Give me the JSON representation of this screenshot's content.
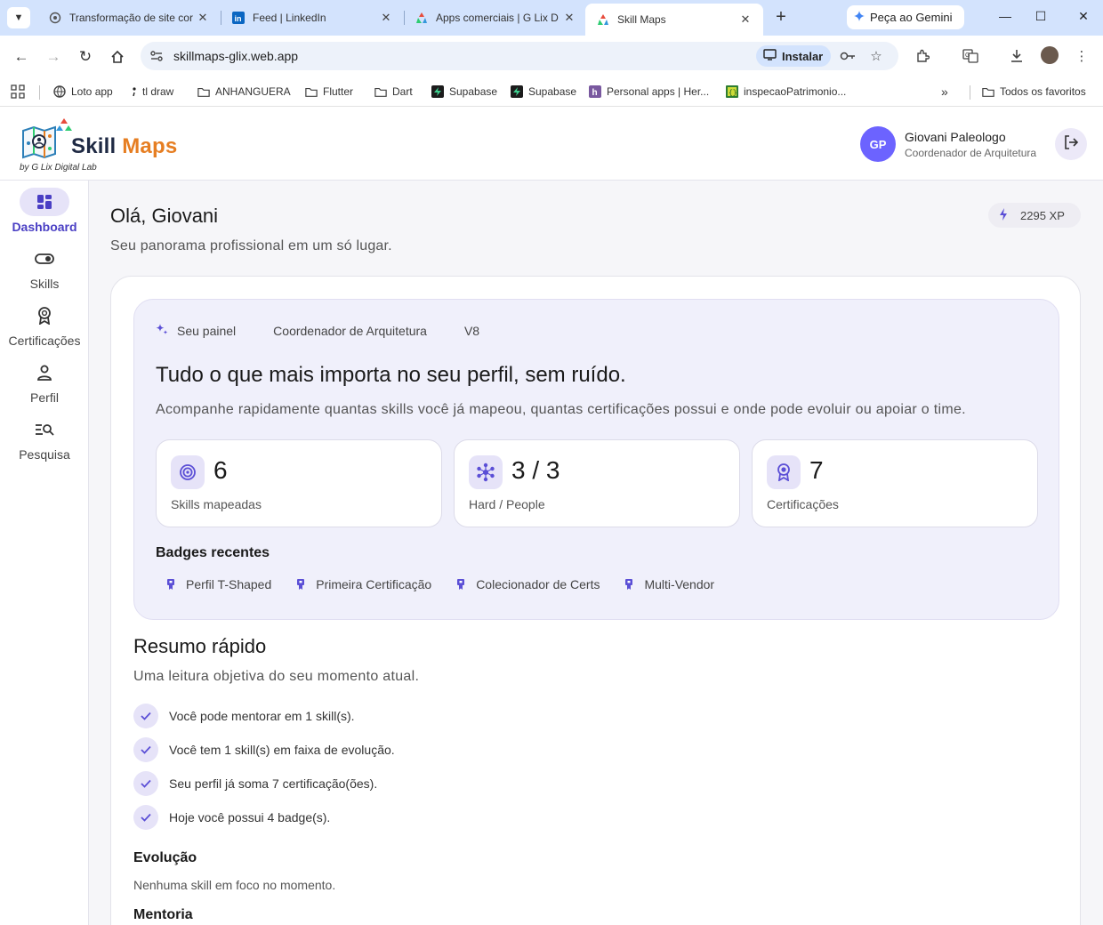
{
  "browser": {
    "tabs": [
      {
        "title": "Transformação de site cor",
        "icon": "openai-icon"
      },
      {
        "title": "Feed | LinkedIn",
        "icon": "linkedin-icon"
      },
      {
        "title": "Apps comerciais | G Lix D",
        "icon": "glix-icon"
      },
      {
        "title": "Skill Maps",
        "icon": "glix-icon",
        "active": true
      }
    ],
    "gemini_label": "Peça ao Gemini",
    "url": "skillmaps-glix.web.app",
    "install_label": "Instalar",
    "bookmarks": [
      {
        "label": "Loto app",
        "icon": "globe-icon"
      },
      {
        "label": "tl draw",
        "icon": "tldraw-icon"
      },
      {
        "label": "ANHANGUERA",
        "icon": "folder-icon"
      },
      {
        "label": "Flutter",
        "icon": "folder-icon"
      },
      {
        "label": "Dart",
        "icon": "folder-icon"
      },
      {
        "label": "Supabase",
        "icon": "supabase-icon"
      },
      {
        "label": "Supabase",
        "icon": "supabase-icon"
      },
      {
        "label": "Personal apps | Her...",
        "icon": "heroku-icon"
      },
      {
        "label": "inspecaoPatrimonio...",
        "icon": "script-icon"
      }
    ],
    "all_bookmarks_label": "Todos os favoritos"
  },
  "header": {
    "logo_word1": "Skill",
    "logo_word2": "Maps",
    "logo_sub": "by G Lix Digital Lab",
    "user_initials": "GP",
    "user_name": "Giovani Paleologo",
    "user_role": "Coordenador de Arquitetura"
  },
  "sidebar": {
    "items": [
      {
        "label": "Dashboard",
        "icon": "dashboard-icon",
        "active": true
      },
      {
        "label": "Skills",
        "icon": "toggle-icon"
      },
      {
        "label": "Certificações",
        "icon": "award-icon"
      },
      {
        "label": "Perfil",
        "icon": "person-icon"
      },
      {
        "label": "Pesquisa",
        "icon": "search-list-icon"
      }
    ]
  },
  "main": {
    "greeting": "Olá, Giovani",
    "subtitle": "Seu panorama profissional em um só lugar.",
    "xp": "2295 XP",
    "hero": {
      "chips": [
        "Seu painel",
        "Coordenador de Arquitetura",
        "V8"
      ],
      "title": "Tudo o que mais importa no seu perfil, sem ruído.",
      "description": "Acompanhe rapidamente quantas skills você já mapeou, quantas certificações possui e onde pode evoluir ou apoiar o time.",
      "stats": [
        {
          "value": "6",
          "label": "Skills mapeadas",
          "icon": "target-icon"
        },
        {
          "value": "3 / 3",
          "label": "Hard / People",
          "icon": "hub-icon"
        },
        {
          "value": "7",
          "label": "Certificações",
          "icon": "medal-icon"
        }
      ],
      "badges_title": "Badges recentes",
      "badges": [
        "Perfil T-Shaped",
        "Primeira Certificação",
        "Colecionador de Certs",
        "Multi-Vendor"
      ]
    },
    "resumo": {
      "title": "Resumo rápido",
      "subtitle": "Uma leitura objetiva do seu momento atual.",
      "items": [
        "Você pode mentorar em 1 skill(s).",
        "Você tem 1 skill(s) em faixa de evolução.",
        "Seu perfil já soma 7 certificação(ões).",
        "Hoje você possui 4 badge(s)."
      ],
      "evolucao_title": "Evolução",
      "evolucao_text": "Nenhuma skill em foco no momento.",
      "mentoria_title": "Mentoria"
    }
  },
  "colors": {
    "accent": "#6c63ff",
    "accent_dark": "#4a3fc4",
    "accent_soft": "#e6e3f8",
    "hero_bg": "#f0f0fb",
    "page_bg": "#f6f6f9"
  }
}
